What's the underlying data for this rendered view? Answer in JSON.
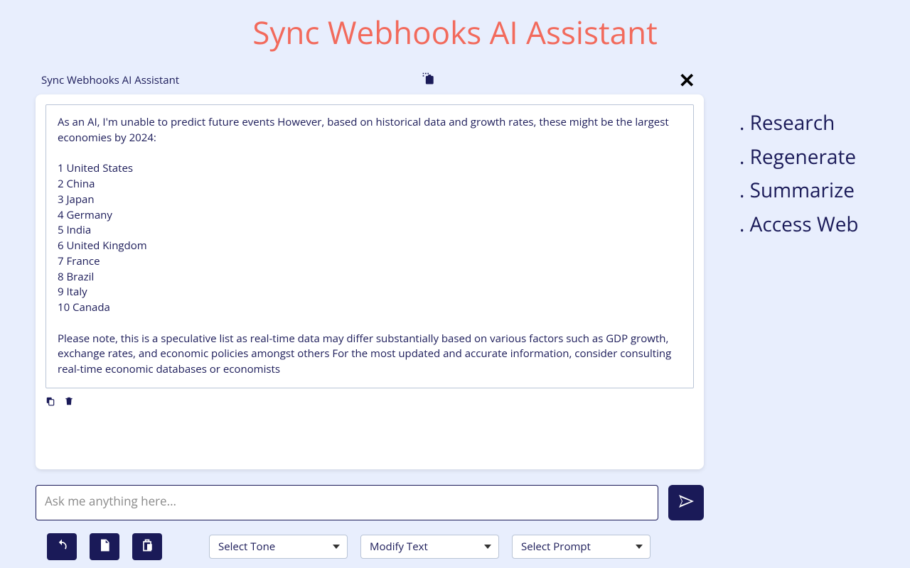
{
  "title": "Sync Webhooks AI Assistant",
  "chat_header": {
    "title": "Sync Webhooks AI Assistant"
  },
  "message": {
    "text": "As an AI, I'm unable to predict future events However, based on historical data and growth rates, these might be the largest economies by 2024:\n\n1 United States\n2 China\n3 Japan\n4 Germany\n5 India\n6 United Kingdom\n7 France\n8 Brazil\n9 Italy\n10 Canada\n\nPlease note, this is a speculative list as real-time data may differ substantially based on various factors such as GDP growth, exchange rates, and economic policies amongst others For the most updated and accurate information, consider consulting real-time economic databases or economists"
  },
  "input": {
    "placeholder": "Ask me anything here..."
  },
  "selects": {
    "tone": "Select Tone",
    "modify": "Modify Text",
    "prompt": "Select Prompt"
  },
  "sidebar": {
    "items": [
      {
        "label": ". Research"
      },
      {
        "label": ". Regenerate"
      },
      {
        "label": ". Summarize"
      },
      {
        "label": ". Access Web"
      }
    ]
  }
}
